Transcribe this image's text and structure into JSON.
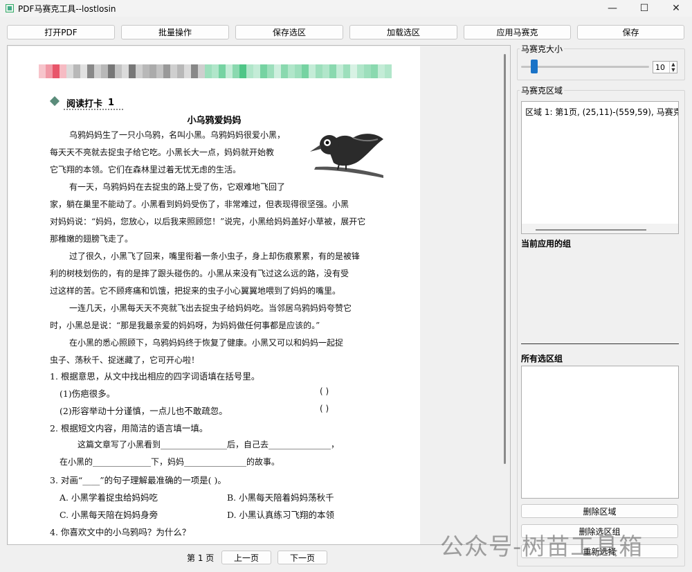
{
  "window": {
    "title": "PDF马赛克工具--lostlosin",
    "minimize": "—",
    "maximize": "☐",
    "close": "✕"
  },
  "toolbar": {
    "open_pdf": "打开PDF",
    "batch": "批量操作",
    "save_selection": "保存选区",
    "load_selection": "加载选区",
    "apply_mosaic": "应用马赛克",
    "save": "保存"
  },
  "document": {
    "heading": "阅读打卡",
    "heading_num": "1",
    "story_title": "小乌鸦爱妈妈",
    "paragraphs": [
      "乌鸦妈妈生了一只小乌鸦，名叫小黑。乌鸦妈妈很爱小黑，",
      "每天天不亮就去捉虫子给它吃。小黑长大一点，妈妈就开始教",
      "它飞翔的本领。它们在森林里过着无忧无虑的生活。",
      "有一天，乌鸦妈妈在去捉虫的路上受了伤，它艰难地飞回了",
      "家，躺在巢里不能动了。小黑看到妈妈受伤了，非常难过，但表现得很坚强。小黑",
      "对妈妈说：“妈妈，您放心，以后我来照顾您！”说完，小黑给妈妈盖好小草被，展开它",
      "那稚嫩的翅膀飞走了。",
      "过了很久，小黑飞了回来，嘴里衔着一条小虫子，身上却伤痕累累，有的是被锋",
      "利的树枝划伤的，有的是摔了跟头碰伤的。小黑从来没有飞过这么远的路，没有受",
      "过这样的苦。它不顾疼痛和饥饿，把捉来的虫子小心翼翼地喂到了妈妈的嘴里。",
      "一连几天，小黑每天天不亮就飞出去捉虫子给妈妈吃。当邻居乌鸦妈妈夸赞它",
      "时，小黑总是说：“那是我最亲爱的妈妈呀，为妈妈做任何事都是应该的。”",
      "在小黑的悉心照顾下，乌鸦妈妈终于恢复了健康。小黑又可以和妈妈一起捉",
      "虫子、荡秋千、捉迷藏了，它可开心啦！"
    ],
    "questions": {
      "q1": "1. 根据意思，从文中找出相应的四字词语填在括号里。",
      "q1a": "(1)伤疤很多。",
      "q1b": "(2)形容举动十分谨慎，一点儿也不敢疏忽。",
      "paren": "(                 )",
      "q2": "2. 根据短文内容，用简洁的语言填一填。",
      "q2a": "这篇文章写了小黑看到________________后，自己去_______________，",
      "q2b": "在小黑的______________下，妈妈_______________的故事。",
      "q3": "3. 对画“____”的句子理解最准确的一项是(      )。",
      "q3a": "A. 小黑学着捉虫给妈妈吃",
      "q3b": "B. 小黑每天陪着妈妈荡秋千",
      "q3c": "C. 小黑每天陪在妈妈身旁",
      "q3d": "D. 小黑认真练习飞翔的本领",
      "q4": "4. 你喜欢文中的小乌鸦吗？为什么？"
    }
  },
  "pager": {
    "page_label": "第 1 页",
    "prev": "上一页",
    "next": "下一页"
  },
  "panel": {
    "mosaic_size_label": "马赛克大小",
    "mosaic_size_value": "10",
    "mosaic_size_level": 0.1,
    "mosaic_region_label": "马赛克区域",
    "region_item": "区域 1: 第1页, (25,11)-(559,59), 马赛克大",
    "applied_group_title": "当前应用的组",
    "all_groups_title": "所有选区组",
    "delete_region": "删除区域",
    "delete_group": "删除选区组",
    "reselect": "重新选择"
  },
  "watermark": "公众号-树苗工具箱",
  "colors": {
    "accent": "#1a73c7",
    "mosaic_red": "#e8556a",
    "mosaic_green": "#3cc07a"
  }
}
